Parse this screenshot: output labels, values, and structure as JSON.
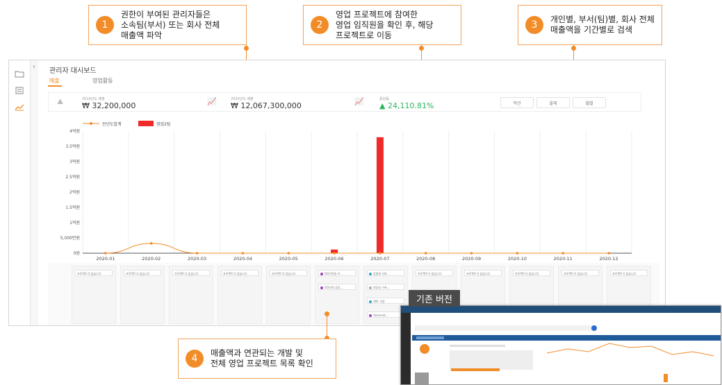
{
  "callouts": [
    {
      "num": "1",
      "text": "권한이 부여된 관리자들은\n소속팀(부서) 또는 회사 전체\n매출액 파악"
    },
    {
      "num": "2",
      "text": "영업 프로젝트에 참여한\n영업 임직원을 확인 후, 해당\n프로젝트로 이동"
    },
    {
      "num": "3",
      "text": "개인별, 부서(팀)별, 회사 전체\n매출액을 기간별로 검색"
    },
    {
      "num": "4",
      "text": "매출액과 연관되는 개발 및\n전체 영업 프로젝트 목록 확인"
    }
  ],
  "app": {
    "title": "관리자 대시보드",
    "tabs": [
      "매출",
      "영업활동"
    ],
    "stats": [
      {
        "label": "2019년도 매출",
        "value": "₩ 32,200,000"
      },
      {
        "label": "2020년도 매출",
        "value": "₩ 12,067,300,000"
      },
      {
        "label": "증감률",
        "value": "▲ 24,110.81%"
      }
    ],
    "period_buttons": [
      "작년",
      "올해",
      "월별"
    ],
    "sidebar_icons": [
      "folder-icon",
      "list-icon",
      "chart-icon"
    ]
  },
  "chart_data": {
    "type": "bar",
    "categories": [
      "2020-01",
      "2020-02",
      "2020-03",
      "2020-04",
      "2020-05",
      "2020-06",
      "2020-07",
      "2020-08",
      "2020-09",
      "2020-10",
      "2020-11",
      "2020-12"
    ],
    "yticks": [
      "0원",
      "5,000만원",
      "1억원",
      "1.5억원",
      "2억원",
      "2.5억원",
      "3억원",
      "3.5억원",
      "4억원"
    ],
    "ylim": [
      0,
      400000000
    ],
    "series": [
      {
        "name": "전년도합계",
        "kind": "line",
        "color": "#f28c28",
        "values": [
          0,
          32200000,
          0,
          0,
          0,
          0,
          0,
          0,
          0,
          0,
          0,
          0
        ]
      },
      {
        "name": "영업2팀",
        "kind": "bar",
        "color": "#f02a2a",
        "values": [
          0,
          0,
          0,
          0,
          0,
          12000000,
          380000000,
          0,
          0,
          0,
          0,
          0
        ]
      }
    ]
  },
  "projects": {
    "empty_text": "프로젝트가 없습니다",
    "columns": [
      {
        "items": []
      },
      {
        "items": []
      },
      {
        "items": []
      },
      {
        "items": []
      },
      {
        "items": []
      },
      {
        "items": [
          {
            "text": "OO지역일 프...",
            "color": "#9b3fc0"
          },
          {
            "text": "OO지역 공동...",
            "color": "#9b3fc0"
          }
        ]
      },
      {
        "items": [
          {
            "text": "동물원 사파...",
            "color": "#2aa7c9"
          },
          {
            "text": "전당대 구축...",
            "color": "#aaaaaa"
          },
          {
            "text": "ABC 자동",
            "color": "#2aa7c9"
          },
          {
            "text": "Aerosmit...",
            "color": "#9b3fc0"
          }
        ]
      },
      {
        "items": []
      },
      {
        "items": []
      },
      {
        "items": []
      },
      {
        "items": []
      },
      {
        "items": []
      }
    ]
  },
  "legacy": {
    "label": "기존 버전"
  }
}
